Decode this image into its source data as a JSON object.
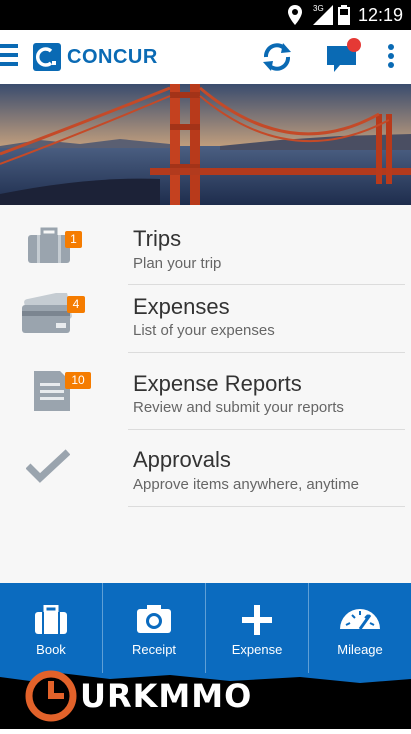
{
  "status_bar": {
    "time": "12:19",
    "network": "3G"
  },
  "app": {
    "logo_text": "CONCUR"
  },
  "menu": [
    {
      "title": "Trips",
      "subtitle": "Plan your trip",
      "badge": "1",
      "icon": "briefcase-icon"
    },
    {
      "title": "Expenses",
      "subtitle": "List of your expenses",
      "badge": "4",
      "icon": "credit-card-icon"
    },
    {
      "title": "Expense Reports",
      "subtitle": "Review and submit your reports",
      "badge": "10",
      "icon": "document-icon"
    },
    {
      "title": "Approvals",
      "subtitle": "Approve items anywhere, anytime",
      "icon": "checkmark-icon"
    }
  ],
  "tabs": [
    {
      "label": "Book",
      "icon": "briefcase-icon"
    },
    {
      "label": "Receipt",
      "icon": "camera-icon"
    },
    {
      "label": "Expense",
      "icon": "plus-icon"
    },
    {
      "label": "Mileage",
      "icon": "speedometer-icon"
    }
  ],
  "watermark": {
    "text": "URKMMO"
  },
  "colors": {
    "brand": "#0a6ab4",
    "tabbar": "#0b6bbf",
    "badge": "#f57c00",
    "notification": "#e53935"
  }
}
